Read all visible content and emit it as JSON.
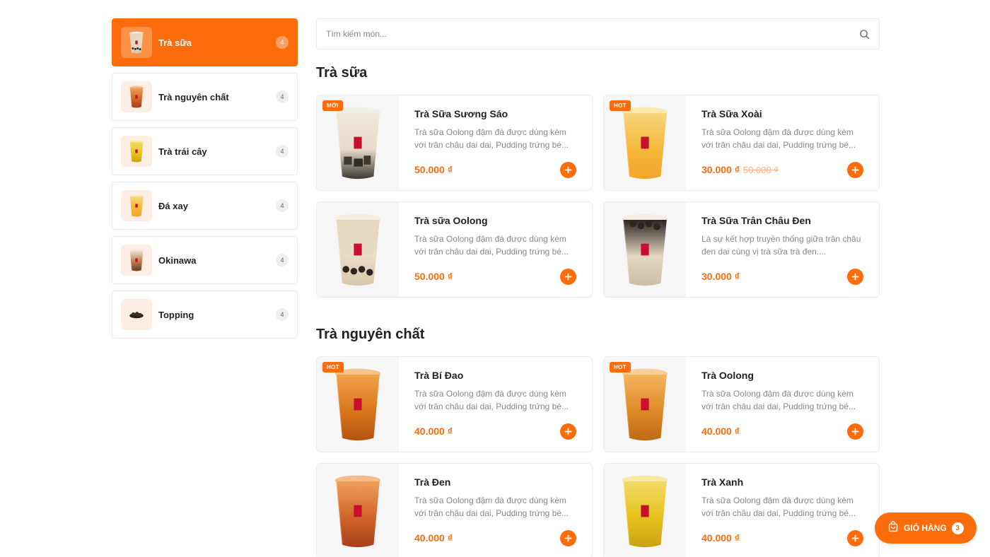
{
  "search": {
    "placeholder": "Tìm kiếm món..."
  },
  "colors": {
    "accent": "#fc6c0b",
    "milk_tea": "#e9dcc6",
    "amber_tea": "#d9771c",
    "black_tea": "#c9561a",
    "green_tea": "#e6c21c",
    "mango": "#f4b83a",
    "taro": "#6b4a3a"
  },
  "categories": [
    {
      "name": "Trà sữa",
      "count": "4",
      "icon": "milk-tea-icon",
      "active": true
    },
    {
      "name": "Trà nguyên chất",
      "count": "4",
      "icon": "amber-tea-icon",
      "active": false
    },
    {
      "name": "Trà trái cây",
      "count": "4",
      "icon": "fruit-tea-icon",
      "active": false
    },
    {
      "name": "Đá xay",
      "count": "4",
      "icon": "smoothie-icon",
      "active": false
    },
    {
      "name": "Okinawa",
      "count": "4",
      "icon": "okinawa-tea-icon",
      "active": false
    },
    {
      "name": "Topping",
      "count": "4",
      "icon": "topping-icon",
      "active": false
    }
  ],
  "sections": [
    {
      "title": "Trà sữa",
      "products": [
        {
          "name": "Trà Sữa Sương Sáo",
          "desc": "Trà sữa Oolong đậm đà được dùng kèm với trân châu dai dai, Pudding trứng bé...",
          "price": "50.000 ₫",
          "old_price": "",
          "badge": "MỚI",
          "drink": "milk-grass-jelly"
        },
        {
          "name": "Trà Sữa Xoài",
          "desc": "Trà sữa Oolong đậm đà được dùng kèm với trân châu dai dai, Pudding trứng bé...",
          "price": "30.000 ₫",
          "old_price": "50.000 ₫",
          "badge": "HOT",
          "drink": "mango"
        },
        {
          "name": "Trà sữa Oolong",
          "desc": "Trà sữa Oolong đậm đà được dùng kèm với trân châu dai dai, Pudding trứng bé...",
          "price": "50.000 ₫",
          "old_price": "",
          "badge": "",
          "drink": "milk-pearls"
        },
        {
          "name": "Trà Sữa Trân Châu Đen",
          "desc": "Là sự kết hợp truyền thống giữa trân châu đen dai cùng vị trà sữa trà đen....",
          "price": "30.000 ₫",
          "old_price": "",
          "badge": "",
          "drink": "milk-black-pearls"
        }
      ]
    },
    {
      "title": "Trà nguyên chất",
      "products": [
        {
          "name": "Trà Bí Đao",
          "desc": "Trà sữa Oolong đậm đà được dùng kèm với trân châu dai dai, Pudding trứng bé...",
          "price": "40.000 ₫",
          "old_price": "",
          "badge": "HOT",
          "drink": "amber"
        },
        {
          "name": "Trà Oolong",
          "desc": "Trà sữa Oolong đậm đà được dùng kèm với trân châu dai dai, Pudding trứng bé...",
          "price": "40.000 ₫",
          "old_price": "",
          "badge": "HOT",
          "drink": "amber-light"
        },
        {
          "name": "Trà Đen",
          "desc": "Trà sữa Oolong đậm đà được dùng kèm với trân châu dai dai, Pudding trứng bé...",
          "price": "40.000 ₫",
          "old_price": "",
          "badge": "",
          "drink": "black-tea"
        },
        {
          "name": "Trà Xanh",
          "desc": "Trà sữa Oolong đậm đà được dùng kèm với trân châu dai dai, Pudding trứng bé...",
          "price": "40.000 ₫",
          "old_price": "",
          "badge": "",
          "drink": "green-tea"
        }
      ]
    }
  ],
  "cart": {
    "label": "GIỎ HÀNG",
    "count": "3",
    "icon": "shopping-bag-icon"
  }
}
